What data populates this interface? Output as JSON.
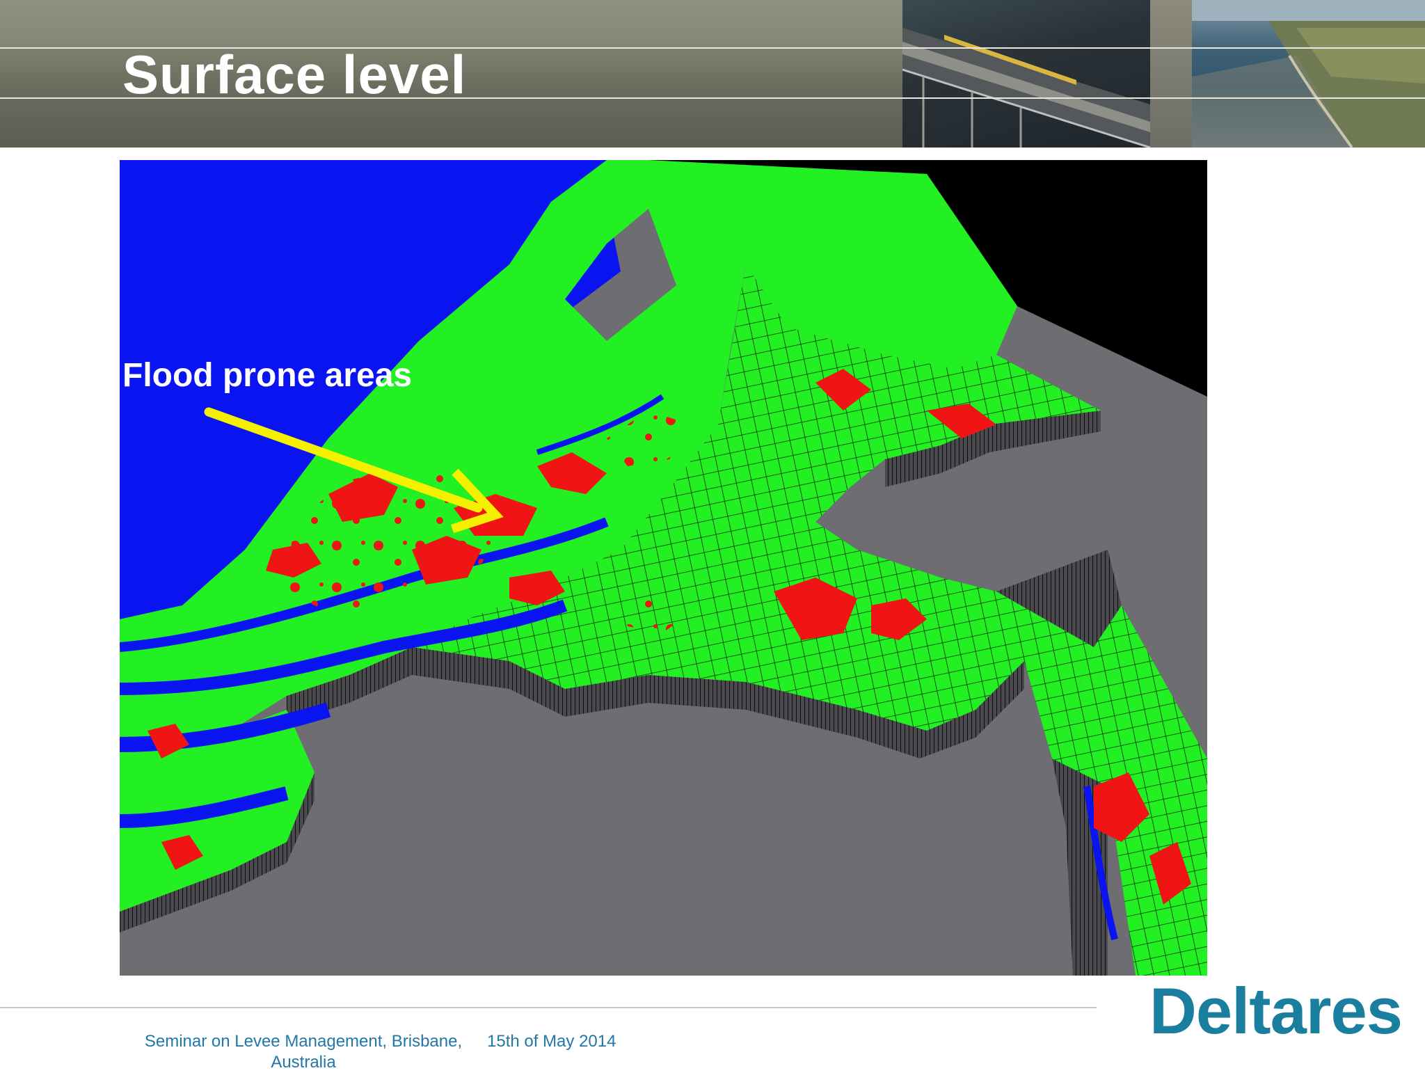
{
  "slide": {
    "title": "Surface level",
    "callout": "Flood prone areas"
  },
  "footer": {
    "event": "Seminar on Levee Management, Brisbane, Australia",
    "date": "15th of May 2014"
  },
  "logo": {
    "text": "Deltares"
  },
  "colors": {
    "header": "#7d7e6e",
    "title": "#ffffff",
    "water": "#0a14f0",
    "land": "#22f022",
    "flood_prone": "#f01414",
    "arrow": "#f5f000",
    "base": "#6e6d72",
    "footer_text": "#2277a8",
    "logo": "#1a7e9f"
  }
}
